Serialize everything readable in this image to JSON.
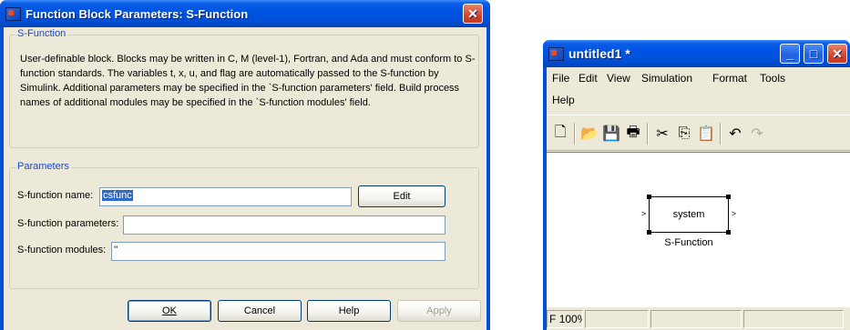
{
  "dialog": {
    "title": "Function Block Parameters: S-Function",
    "group1_label": "S-Function",
    "description": "User-definable block.  Blocks may be written in C, M (level-1), Fortran, and Ada and must conform to S-function standards.  The variables t, x, u, and flag are automatically passed to the S-function by Simulink.  Additional parameters may be specified in the `S-function parameters' field. Build process names of additional modules may be specified in the `S-function modules' field.",
    "group2_label": "Parameters",
    "name_label": "S-function name:",
    "name_value": "csfunc",
    "edit_button": "Edit",
    "params_label": "S-function parameters:",
    "params_value": "",
    "modules_label": "S-function modules:",
    "modules_value": "''",
    "buttons": {
      "ok": "OK",
      "cancel": "Cancel",
      "help": "Help",
      "apply": "Apply"
    }
  },
  "model": {
    "title": "untitled1 *",
    "menu": {
      "file": "File",
      "edit": "Edit",
      "view": "View",
      "simulation": "Simulation",
      "format": "Format",
      "tools": "Tools",
      "help": "Help"
    },
    "block": {
      "text": "system",
      "caption": "S-Function"
    },
    "status": {
      "left": "F",
      "zoom": "100%"
    }
  },
  "colors": {
    "titlebar": "#0054e3",
    "dialog_face": "#ece9d8",
    "group_label": "#1c48c8",
    "selection": "#316ac5",
    "close_button": "#d4442c"
  }
}
